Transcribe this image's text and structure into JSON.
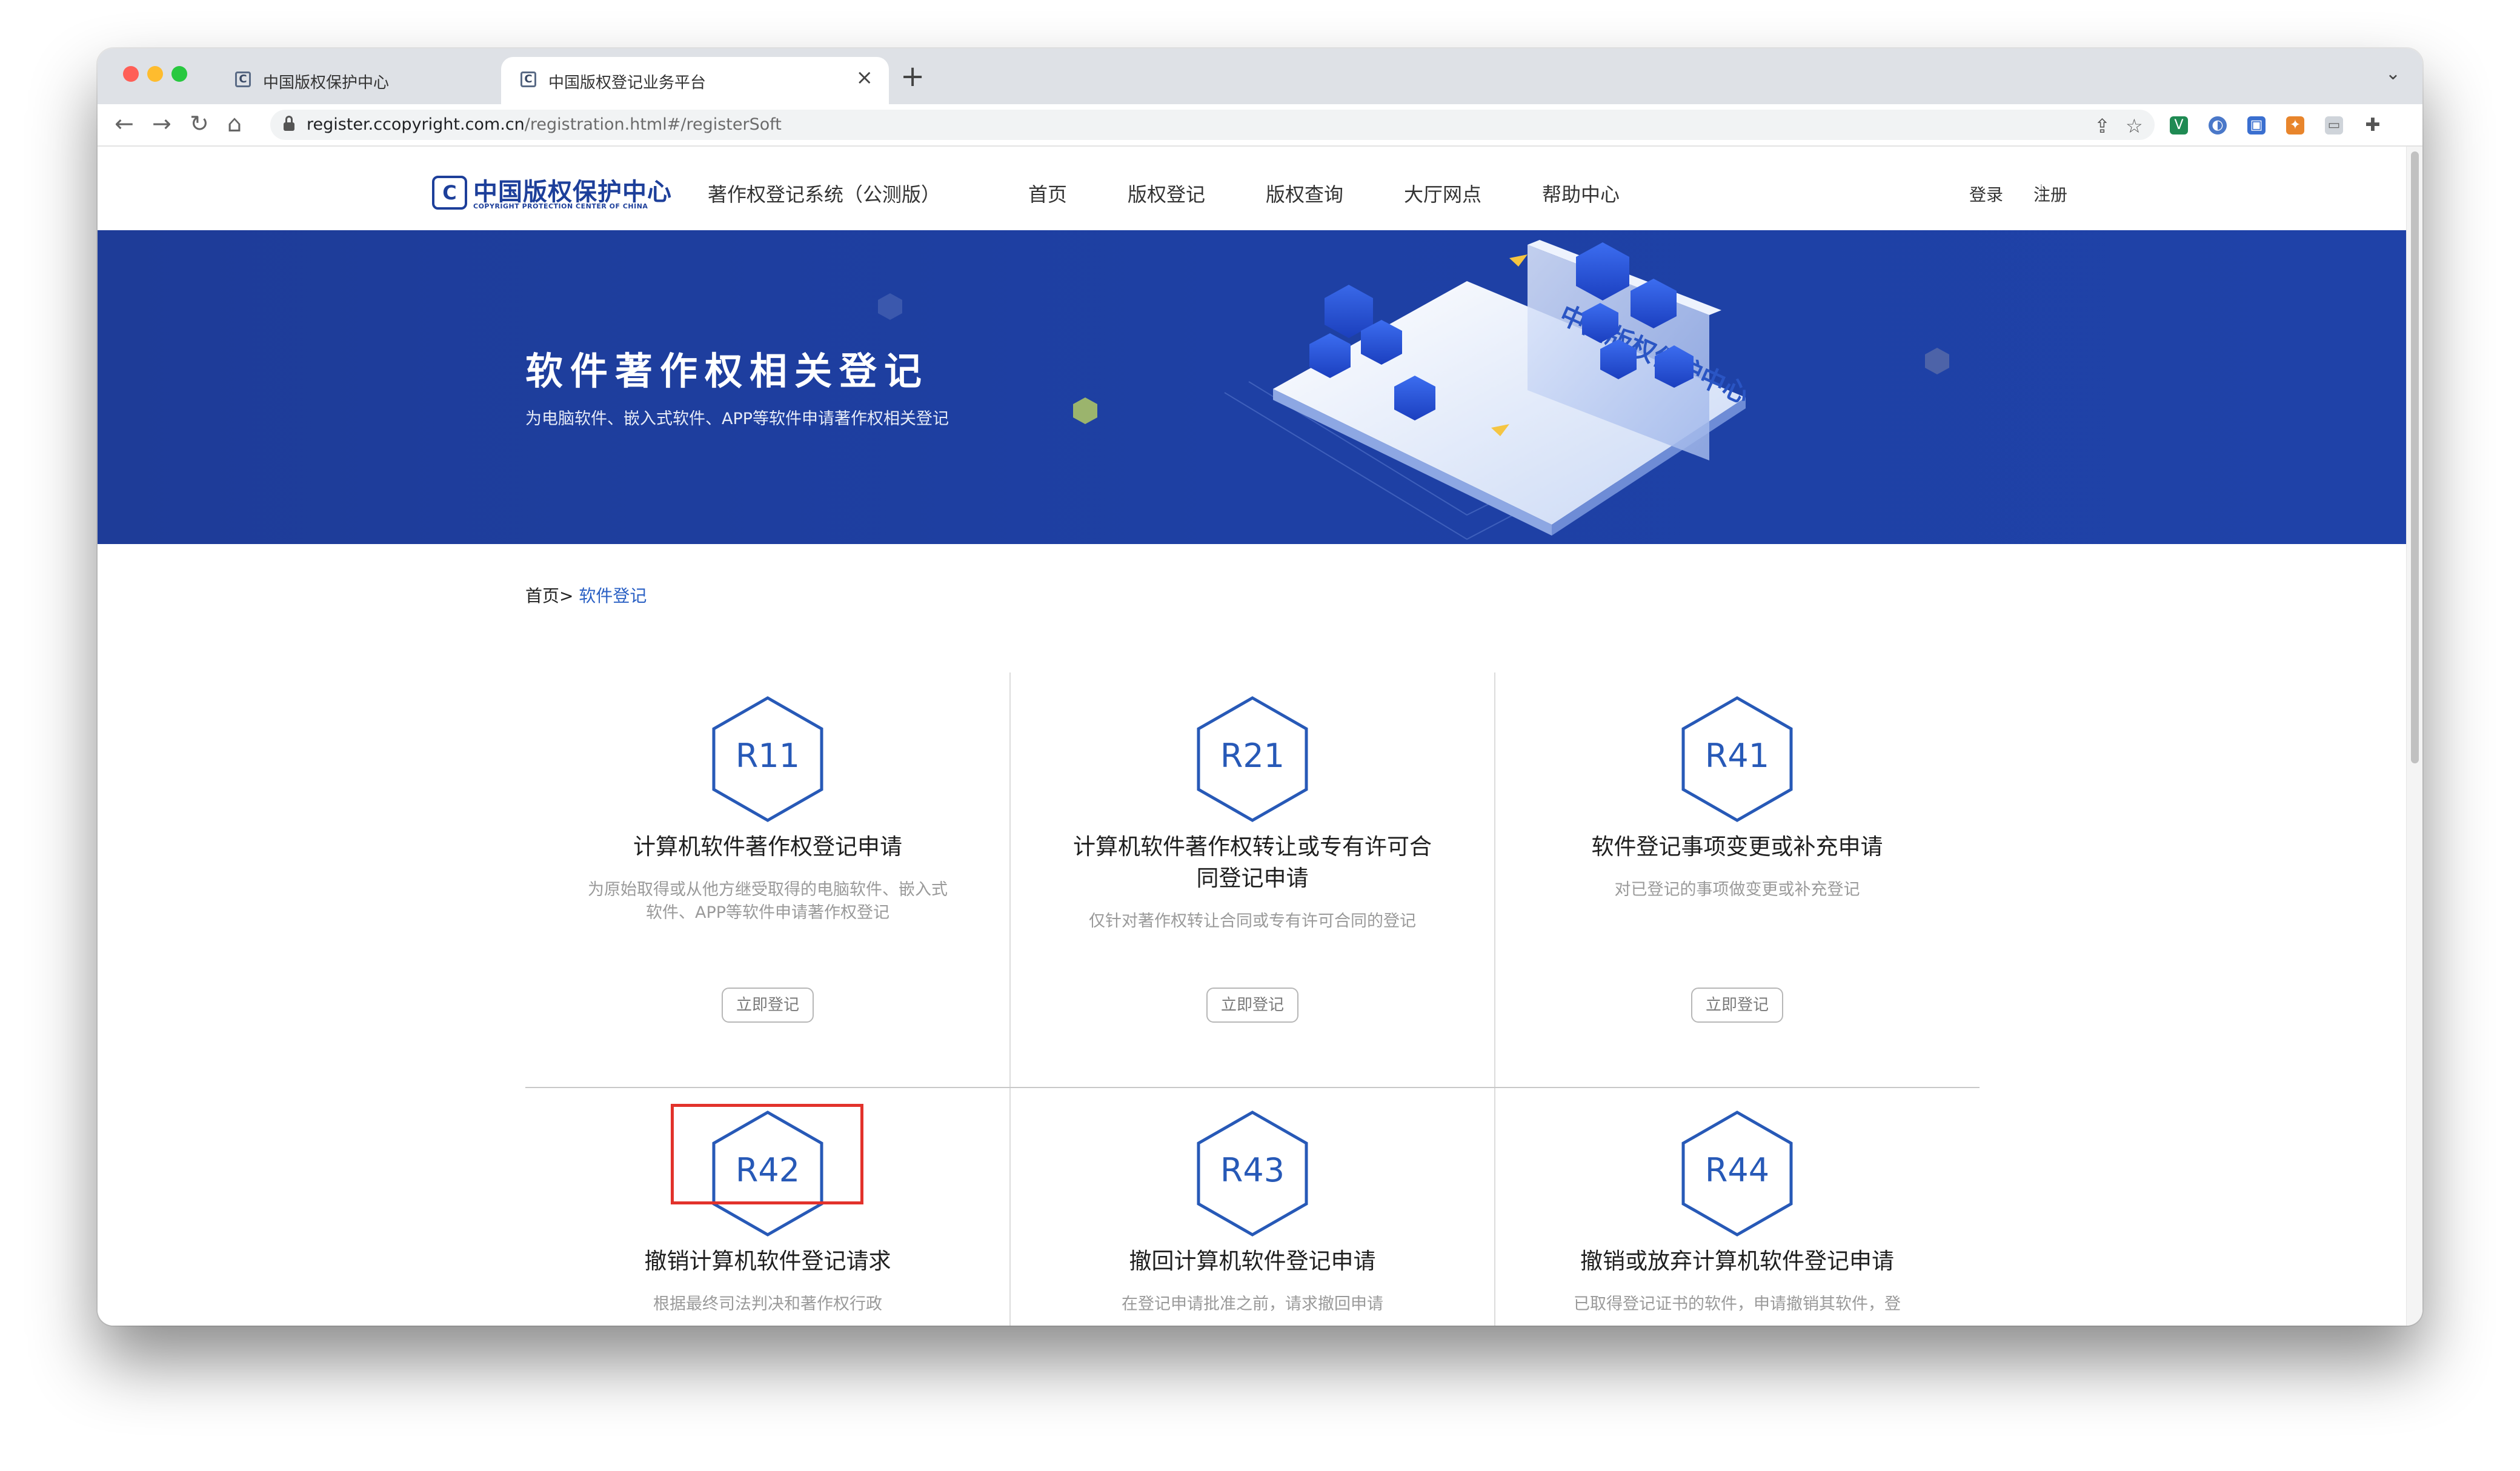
{
  "browser": {
    "tabs": [
      {
        "title": "中国版权保护中心",
        "active": false
      },
      {
        "title": "中国版权登记业务平台",
        "active": true
      }
    ],
    "new_tab_label": "+",
    "url_host": "register.ccopyright.com.cn",
    "url_path": "/registration.html#/registerSoft"
  },
  "site": {
    "logo_cn": "中国版权保护中心",
    "logo_en": "COPYRIGHT PROTECTION CENTER OF CHINA",
    "logo_mark": "C",
    "system_name": "著作权登记系统（公测版）",
    "nav": [
      "首页",
      "版权登记",
      "版权查询",
      "大厅网点",
      "帮助中心"
    ],
    "login": "登录",
    "register": "注册"
  },
  "banner": {
    "title": "软件著作权相关登记",
    "subtitle": "为电脑软件、嵌入式软件、APP等软件申请著作权相关登记",
    "illustration_text": "中国版权保护中心"
  },
  "breadcrumb": {
    "home": "首页>",
    "current": "软件登记"
  },
  "cards": [
    {
      "code": "R11",
      "title": "计算机软件著作权登记申请",
      "desc": "为原始取得或从他方继受取得的电脑软件、嵌入式软件、APP等软件申请著作权登记",
      "button": "立即登记"
    },
    {
      "code": "R21",
      "title": "计算机软件著作权转让或专有许可合同登记申请",
      "desc": "仅针对著作权转让合同或专有许可合同的登记",
      "button": "立即登记"
    },
    {
      "code": "R41",
      "title": "软件登记事项变更或补充申请",
      "desc": "对已登记的事项做变更或补充登记",
      "button": "立即登记"
    },
    {
      "code": "R42",
      "title": "撤销计算机软件登记请求",
      "desc": "根据最终司法判决和著作权行政"
    },
    {
      "code": "R43",
      "title": "撤回计算机软件登记申请",
      "desc": "在登记申请批准之前，请求撤回申请"
    },
    {
      "code": "R44",
      "title": "撤销或放弃计算机软件登记申请",
      "desc": "已取得登记证书的软件，申请撤销其软件，登"
    }
  ],
  "colors": {
    "brand_blue": "#1e40a4",
    "code_blue": "#2759b7",
    "highlight_red": "#e2322b"
  }
}
